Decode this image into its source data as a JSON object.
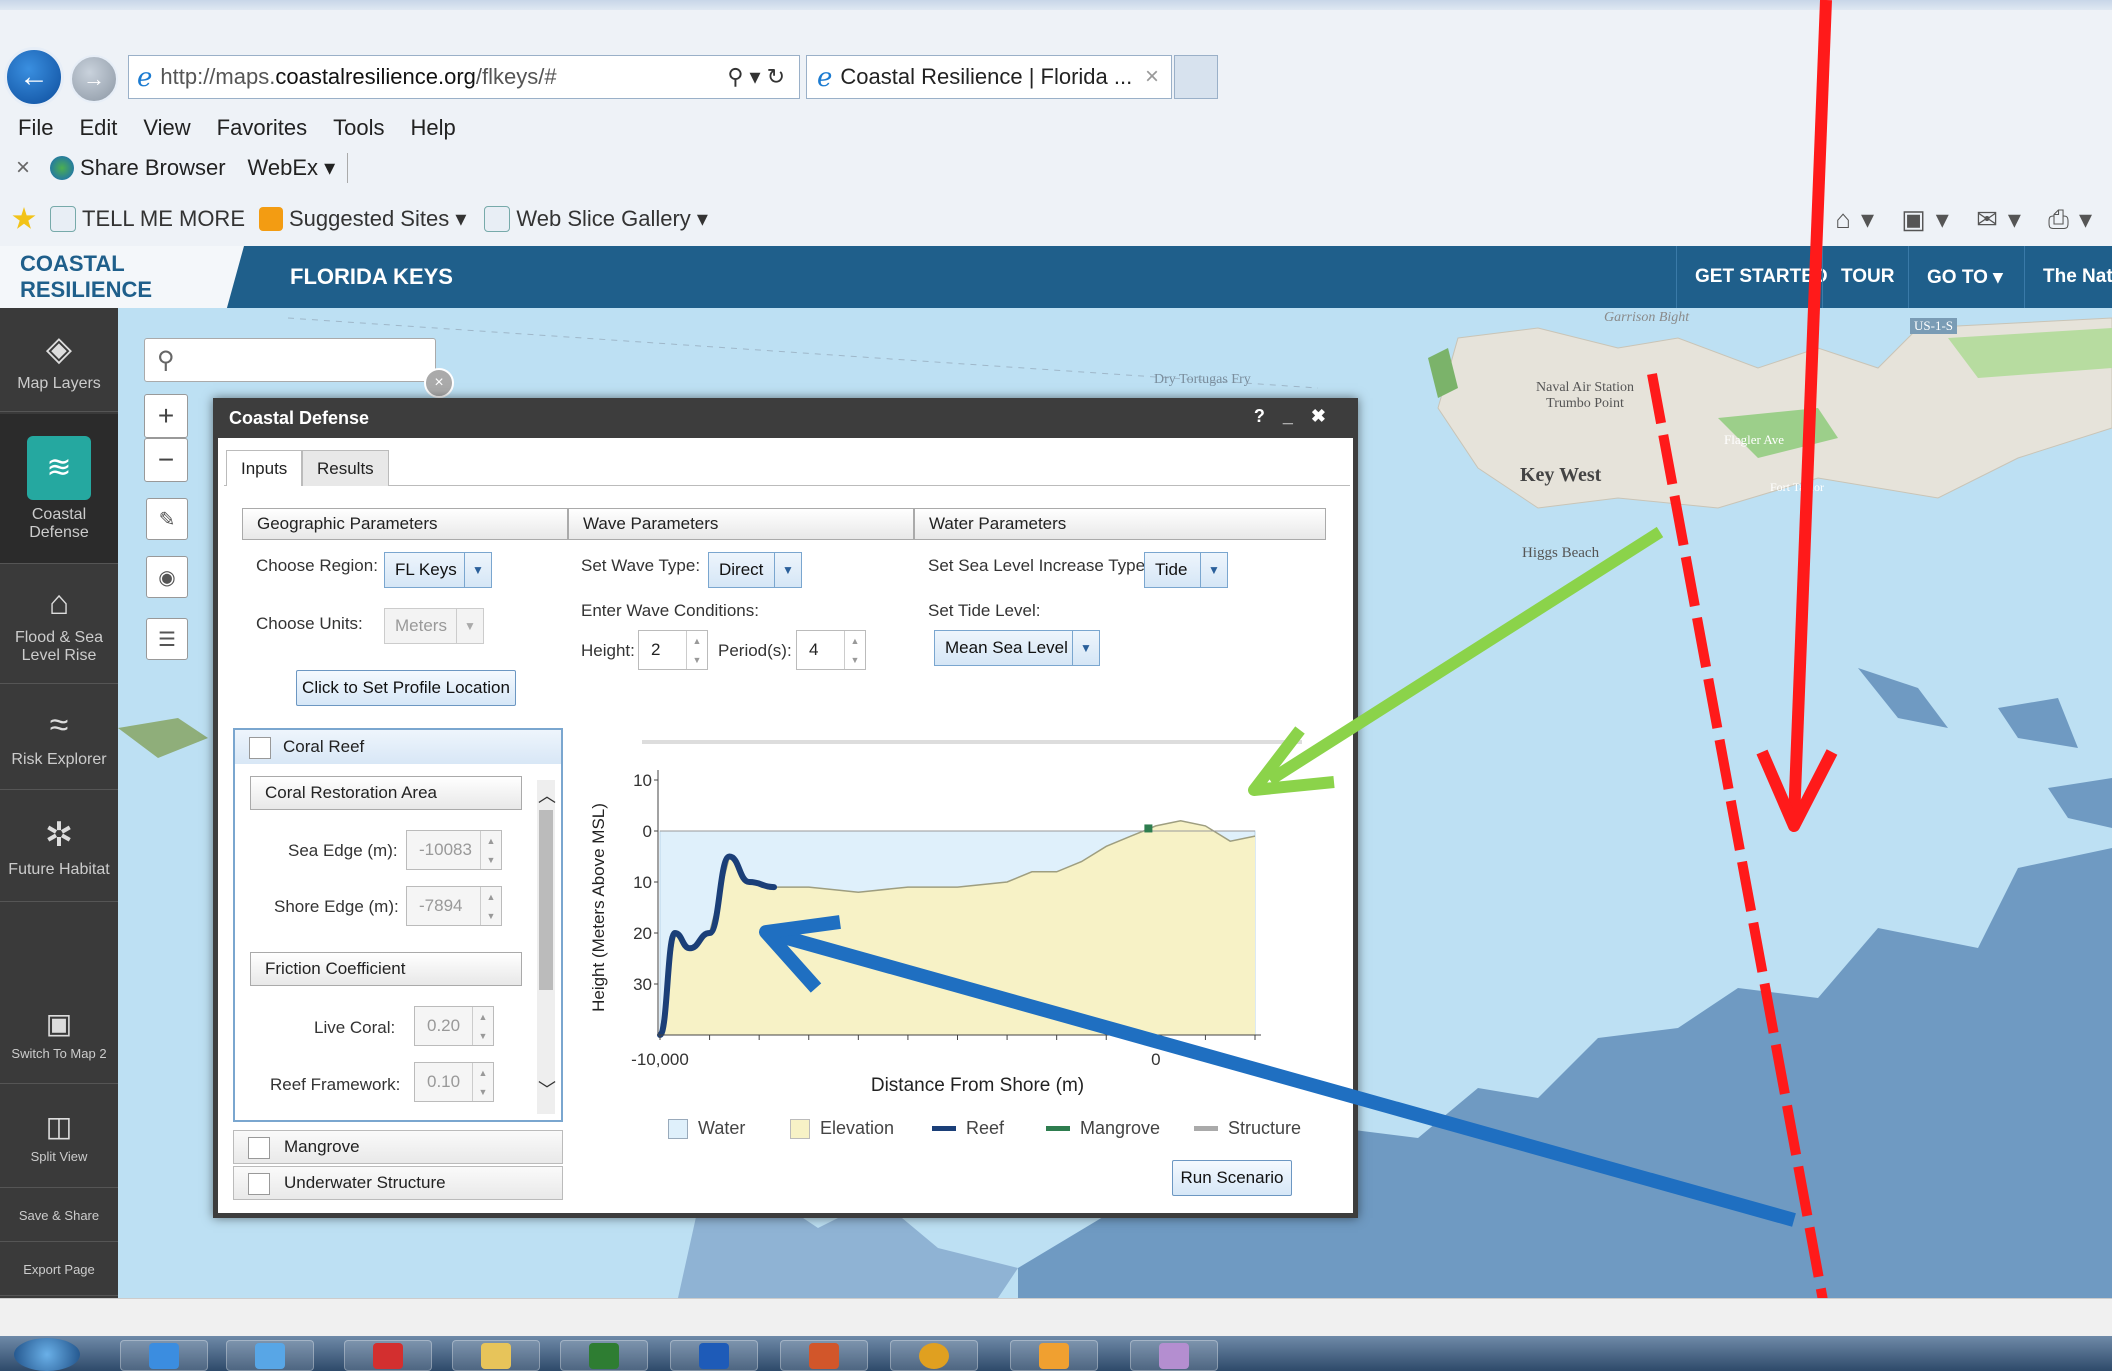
{
  "browser": {
    "url_prefix": "http://maps.",
    "url_domain": "coastalresilience.org",
    "url_path": "/flkeys/#",
    "tab_title": "Coastal Resilience | Florida ...",
    "menu": [
      "File",
      "Edit",
      "View",
      "Favorites",
      "Tools",
      "Help"
    ],
    "command_bar": {
      "close": "×",
      "share": "Share Browser",
      "webex": "WebEx ▾"
    },
    "favorites": {
      "tell_me_more": "TELL ME MORE",
      "suggested": "Suggested Sites ▾",
      "web_slice": "Web Slice Gallery ▾"
    }
  },
  "app": {
    "brand": "COASTAL RESILIENCE",
    "region": "FLORIDA KEYS",
    "nav": [
      "GET STARTED",
      "TOUR",
      "GO TO ▾",
      "The Natur"
    ]
  },
  "sidebar": [
    {
      "label": "Map Layers",
      "icon": "layers-icon"
    },
    {
      "label": "Coastal Defense",
      "icon": "wave-icon"
    },
    {
      "label": "Flood & Sea Level Rise",
      "icon": "house-flood-icon"
    },
    {
      "label": "Risk Explorer",
      "icon": "risk-icon"
    },
    {
      "label": "Future Habitat",
      "icon": "plant-icon"
    },
    {
      "label": "Switch To Map 2",
      "icon": "map-icon"
    },
    {
      "label": "Split View",
      "icon": "split-icon"
    },
    {
      "label": "Save & Share",
      "icon": ""
    },
    {
      "label": "Export Page",
      "icon": ""
    }
  ],
  "map": {
    "labels": [
      "Garrison Bight",
      "Naval Air Station Trumbo Point",
      "Key West",
      "Higgs Beach",
      "Dry Tortugas Fry",
      "US-1-S",
      "Flagler Ave",
      "Fort Taylor"
    ],
    "search_placeholder": ""
  },
  "panel": {
    "title": "Coastal Defense",
    "controls": [
      "?",
      "_",
      "✖"
    ],
    "tabs": [
      "Inputs",
      "Results"
    ],
    "geographic": {
      "head": "Geographic Parameters",
      "region_label": "Choose Region:",
      "region_value": "FL Keys",
      "units_label": "Choose Units:",
      "units_value": "Meters",
      "profile_button": "Click to Set Profile Location"
    },
    "wave": {
      "head": "Wave Parameters",
      "type_label": "Set Wave Type:",
      "type_value": "Direct",
      "conditions_label": "Enter Wave Conditions:",
      "height_label": "Height:",
      "height_value": "2",
      "period_label": "Period(s):",
      "period_value": "4"
    },
    "water": {
      "head": "Water Parameters",
      "increase_label": "Set Sea Level Increase Type:",
      "increase_value": "Tide",
      "tide_label": "Set Tide Level:",
      "tide_value": "Mean Sea Level"
    },
    "coral": {
      "head": "Coral Reef",
      "restoration_head": "Coral Restoration Area",
      "sea_edge_label": "Sea Edge (m):",
      "sea_edge_value": "-10083",
      "shore_edge_label": "Shore Edge (m):",
      "shore_edge_value": "-7894",
      "friction_head": "Friction Coefficient",
      "live_coral_label": "Live Coral:",
      "live_coral_value": "0.20",
      "framework_label": "Reef Framework:",
      "framework_value": "0.10"
    },
    "mangrove_head": "Mangrove",
    "underwater_head": "Underwater Structure",
    "run_button": "Run Scenario"
  },
  "chart_data": {
    "type": "area",
    "xlabel": "Distance From Shore (m)",
    "ylabel": "Height (Meters Above MSL)",
    "x_ticks": [
      "-10,000",
      "0"
    ],
    "y_ticks": [
      "10",
      "0",
      "10",
      "20",
      "30"
    ],
    "xlim": [
      -10000,
      2000
    ],
    "ylim": [
      -40,
      10
    ],
    "legend": [
      "Water",
      "Elevation",
      "Reef",
      "Mangrove",
      "Structure"
    ],
    "elevation": {
      "x": [
        -10000,
        -9700,
        -9400,
        -9000,
        -8600,
        -8200,
        -7700,
        -7000,
        -6000,
        -5000,
        -4000,
        -3000,
        -2500,
        -2000,
        -1500,
        -1000,
        -500,
        0,
        500,
        1000,
        1500,
        2000
      ],
      "y": [
        -40,
        -20,
        -23,
        -20,
        -5,
        -10,
        -11,
        -11,
        -12,
        -11,
        -11,
        -10,
        -8,
        -8,
        -6,
        -3,
        -1,
        1,
        2,
        1,
        -2,
        -1
      ]
    },
    "reef": {
      "x": [
        -10000,
        -9700,
        -9400,
        -9000,
        -8600,
        -8200,
        -7700
      ],
      "y": [
        -40,
        -20,
        -23,
        -20,
        -5,
        -10,
        -11
      ]
    },
    "mangrove_point": {
      "x": [
        -150
      ],
      "y": [
        0.5
      ]
    },
    "colors": {
      "water": "#dff0fb",
      "elevation": "#f7f2c6",
      "reef": "#1b3f78",
      "mangrove": "#2e7d4f",
      "structure": "#aaaaaa"
    }
  },
  "annotations": {
    "red_line": "#ff1a1a",
    "green_arrow": "#8bd34a",
    "blue_arrow": "#1f6fc1"
  }
}
